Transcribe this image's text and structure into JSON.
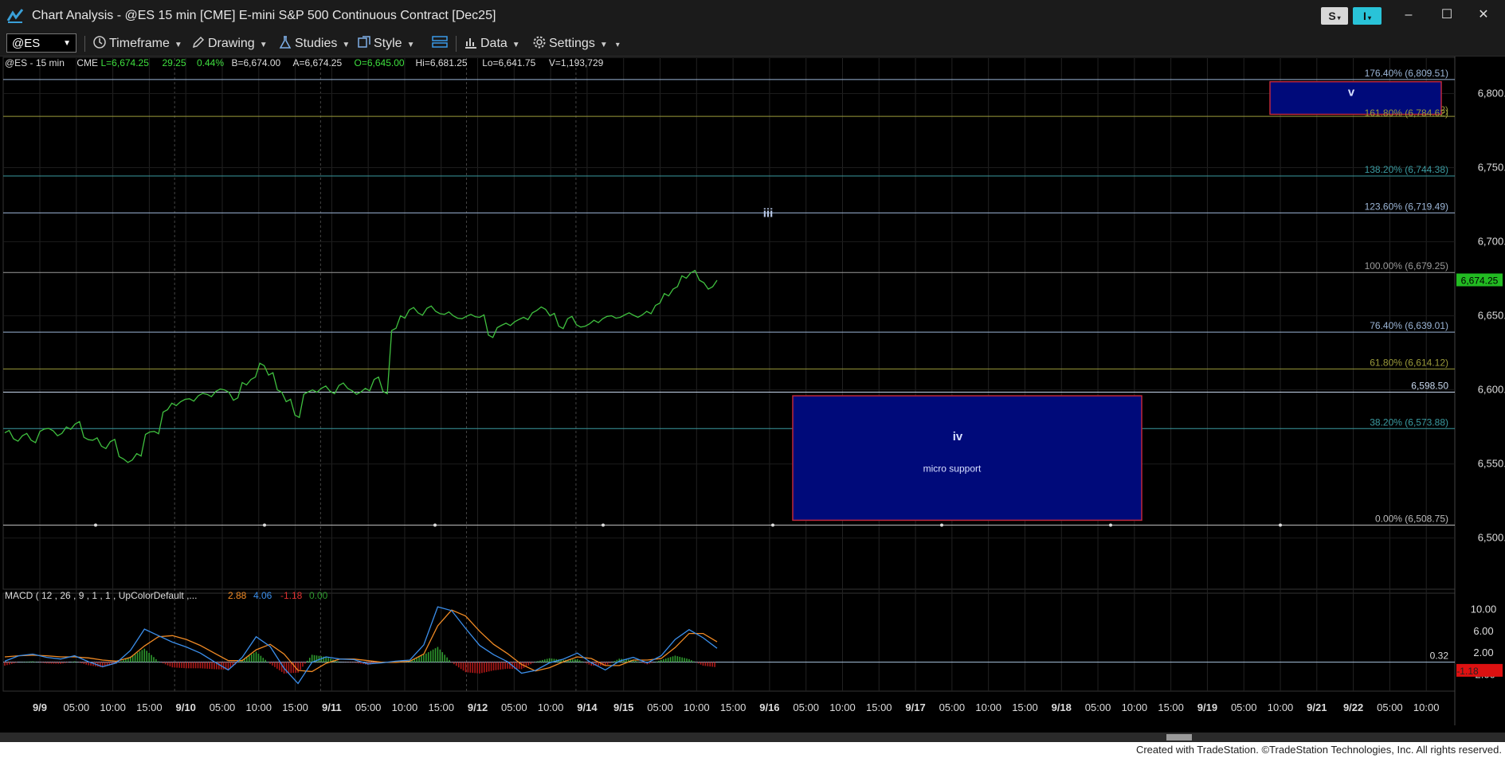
{
  "window": {
    "title": "Chart Analysis - @ES 15 min [CME] E-mini S&P 500 Continuous Contract [Dec25]",
    "s_badge": "S",
    "i_badge": "I",
    "minimize": "–",
    "maximize": "☐",
    "close": "✕"
  },
  "toolbar": {
    "symbol": "@ES",
    "timeframe": "Timeframe",
    "drawing": "Drawing",
    "studies": "Studies",
    "style": "Style",
    "data": "Data",
    "settings": "Settings"
  },
  "header": {
    "symbol": "@ES - 15 min",
    "exchange": "CME",
    "last": "L=6,674.25",
    "change": "29.25",
    "pct": "0.44%",
    "bid": "B=6,674.00",
    "ask": "A=6,674.25",
    "open": "O=6,645.00",
    "high": "Hi=6,681.25",
    "low": "Lo=6,641.75",
    "volume": "V=1,193,729"
  },
  "colors": {
    "price_line": "#3fbf3f",
    "box_fill": "#000a7a",
    "box_border": "#c0283a",
    "macd_line": "#3b8eea",
    "signal_line": "#f08a24",
    "hist_up": "#2e9a2e",
    "hist_down": "#b01818"
  },
  "chart_data": [
    {
      "type": "line",
      "panel": "price",
      "y_ticks": [
        "6,800.00",
        "6,750.00",
        "6,700.00",
        "6,650.00",
        "6,600.00",
        "6,550.00",
        "6,500.00"
      ],
      "ylim": [
        6466,
        6825
      ],
      "last_price_label": "6,674.25",
      "x_labels": [
        "9/9",
        "05:00",
        "10:00",
        "15:00",
        "9/10",
        "05:00",
        "10:00",
        "15:00",
        "9/11",
        "05:00",
        "10:00",
        "15:00",
        "9/12",
        "05:00",
        "10:00",
        "9/14",
        "9/15",
        "05:00",
        "10:00",
        "15:00",
        "9/16",
        "05:00",
        "10:00",
        "15:00",
        "9/17",
        "05:00",
        "10:00",
        "15:00",
        "9/18",
        "05:00",
        "10:00",
        "15:00",
        "9/19",
        "05:00",
        "10:00",
        "9/21",
        "9/22",
        "05:00",
        "10:00"
      ],
      "fib_levels": [
        {
          "label": "176.40% (6,809.51)",
          "value": 6809.51,
          "color": "#9bb5d6"
        },
        {
          "label": "161.80% (6,784.62)",
          "value": 6784.62,
          "color": "#9a9a3a"
        },
        {
          "label": "138.20% (6,744.38)",
          "value": 6744.38,
          "color": "#3a9aa0"
        },
        {
          "label": "123.60% (6,719.49)",
          "value": 6719.49,
          "color": "#9bb5d6"
        },
        {
          "label": "100.00% (6,679.25)",
          "value": 6679.25,
          "color": "#9a9a9a"
        },
        {
          "label": "76.40% (6,639.01)",
          "value": 6639.01,
          "color": "#9bb5d6"
        },
        {
          "label": "61.80% (6,614.12)",
          "value": 6614.12,
          "color": "#9a9a3a"
        },
        {
          "label": "6,598.50",
          "value": 6598.5,
          "color": "#c8d8ee"
        },
        {
          "label": "38.20% (6,573.88)",
          "value": 6573.88,
          "color": "#3a9aa0"
        },
        {
          "label": "0.00% (6,508.75)",
          "value": 6508.75,
          "color": "#bbbbbb"
        }
      ],
      "wave_labels": [
        {
          "text": "iii",
          "x_index": 0.5,
          "value": 6722
        },
        {
          "text": "v",
          "x_index": 0.9,
          "value": 6799
        },
        {
          "text": "iv",
          "x_index": 0.63,
          "value": 6568
        }
      ],
      "annotations": [
        {
          "text": "micro support",
          "value": 6547
        }
      ],
      "boxes": [
        {
          "name": "target-v",
          "y_top": 6808,
          "y_bottom": 6786
        },
        {
          "name": "support-iv",
          "y_top": 6596,
          "y_bottom": 6512
        }
      ],
      "series": [
        {
          "values": [
            6571,
            6567,
            6569,
            6566,
            6572,
            6574,
            6569,
            6575,
            6577,
            6568,
            6566,
            6562,
            6565,
            6555,
            6551,
            6557,
            6570,
            6572,
            6585,
            6591,
            6592,
            6594,
            6596,
            6597,
            6599,
            6600,
            6593,
            6605,
            6607,
            6618,
            6610,
            6600,
            6592,
            6583,
            6597,
            6600,
            6601,
            6599,
            6603,
            6601,
            6597,
            6601,
            6607,
            6599,
            6640,
            6650,
            6654,
            6652,
            6655,
            6653,
            6651,
            6650,
            6648,
            6651,
            6649,
            6637,
            6642,
            6645,
            6646,
            6649,
            6652,
            6656,
            6650,
            6643,
            6648,
            6644,
            6643,
            6647,
            6648,
            6650,
            6649,
            6652,
            6649,
            6653,
            6657,
            6665,
            6668,
            6677,
            6679,
            6674,
            6668,
            6674
          ]
        }
      ]
    },
    {
      "type": "line",
      "panel": "macd",
      "title": "MACD ( 12 , 26 , 9 , 1 , 1 , UpColorDefault ,...",
      "values_shown": {
        "macd": "2.88",
        "signal": "4.06",
        "hist": "-1.18",
        "extra": "0.00"
      },
      "y_ticks": [
        "10.00",
        "6.00",
        "2.00",
        "-2.00"
      ],
      "ylim": [
        -5,
        13
      ],
      "zero_label": "0.32",
      "current_hist_label": "-1.18",
      "series": [
        {
          "name": "MACD",
          "values": [
            0.5,
            1.5,
            1.8,
            1.2,
            0.9,
            1.5,
            0.4,
            -0.5,
            0.2,
            2.5,
            6.4,
            5.2,
            4.0,
            3.1,
            2.0,
            0.4,
            -1.1,
            1.2,
            5.0,
            3.2,
            -0.8,
            -3.6,
            0.3,
            1.3,
            0.9,
            0.8,
            0.0,
            0.2,
            0.5,
            0.7,
            3.5,
            10.5,
            9.8,
            6.5,
            3.4,
            1.7,
            0.4,
            -1.7,
            -1.2,
            0.2,
            0.9,
            2.0,
            0.2,
            -1.1,
            0.5,
            1.2,
            0.2,
            1.5,
            4.5,
            6.3,
            4.8,
            2.88
          ]
        },
        {
          "name": "Signal",
          "values": [
            1.3,
            1.5,
            1.6,
            1.5,
            1.3,
            1.3,
            1.1,
            0.7,
            0.5,
            1.2,
            3.3,
            5.0,
            5.2,
            4.5,
            3.4,
            2.0,
            0.6,
            0.6,
            2.6,
            3.6,
            1.8,
            -1.2,
            -1.4,
            0.1,
            0.9,
            0.9,
            0.6,
            0.3,
            0.3,
            0.5,
            1.8,
            7.0,
            9.9,
            8.8,
            6.0,
            3.6,
            1.9,
            -0.1,
            -1.3,
            -0.7,
            0.4,
            1.3,
            1.0,
            -0.3,
            -0.3,
            0.7,
            0.7,
            1.0,
            3.0,
            5.6,
            5.6,
            4.06
          ]
        }
      ]
    }
  ],
  "footer": {
    "text": "Created with TradeStation. ©TradeStation Technologies, Inc. All rights reserved."
  }
}
